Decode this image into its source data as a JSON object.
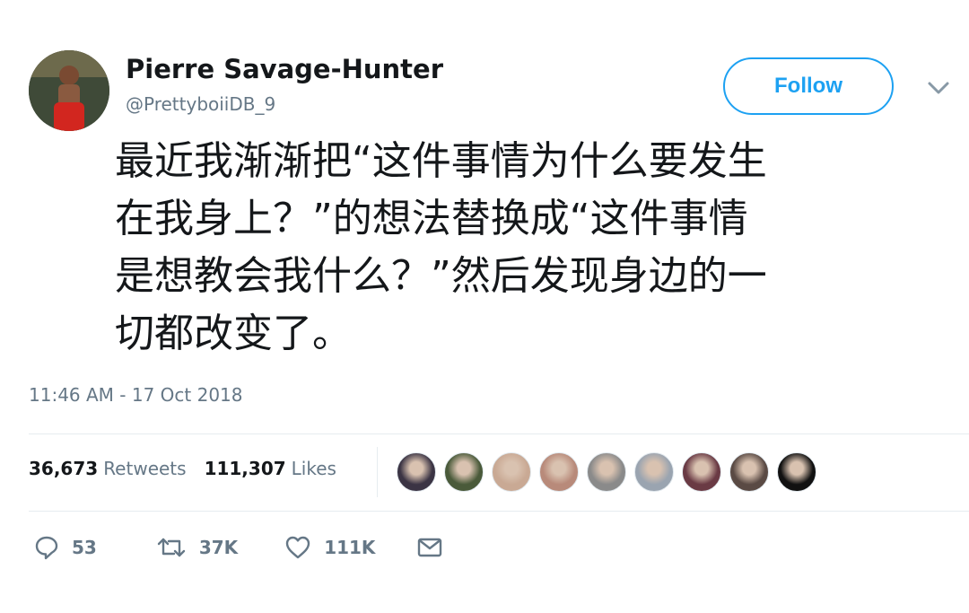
{
  "user": {
    "display_name": "Pierre Savage-Hunter",
    "handle": "@PrettyboiiDB_9"
  },
  "follow_label": "Follow",
  "tweet_lines": [
    "最近我渐渐把“这件事情为什么要发生",
    "在我身上？”的想法替换成“这件事情",
    "是想教会我什么？”然后发现身边的一",
    "切都改变了。"
  ],
  "timestamp": "11:46 AM - 17 Oct 2018",
  "stats": {
    "retweets_count": "36,673",
    "retweets_label": "Retweets",
    "likes_count": "111,307",
    "likes_label": "Likes"
  },
  "actions": {
    "reply_count": "53",
    "retweet_count": "37K",
    "like_count": "111K"
  },
  "liker_avatar_colors": [
    "#3b3444",
    "#4a5a3a",
    "#c9a994",
    "#b88a7a",
    "#8a8a8a",
    "#9aa4b0",
    "#6a3a44",
    "#5a4a44",
    "#111111"
  ],
  "icons": [
    "chevron-down-icon",
    "reply-icon",
    "retweet-icon",
    "heart-icon",
    "message-icon"
  ]
}
